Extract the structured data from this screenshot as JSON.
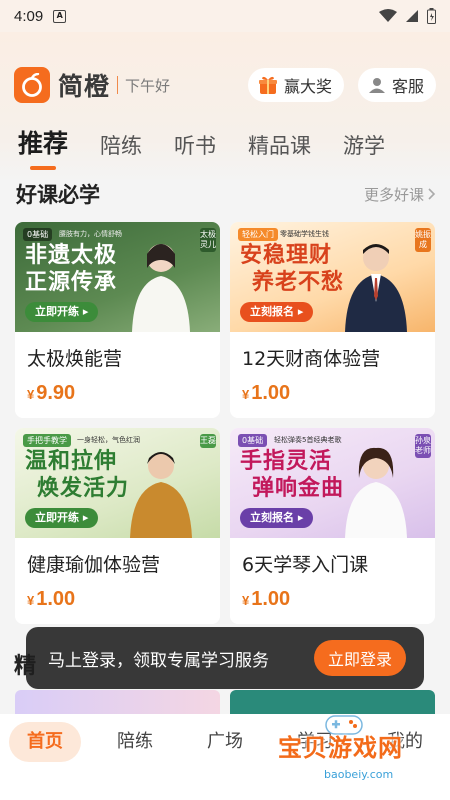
{
  "status_bar": {
    "time": "4:09",
    "sim_glyph": "A"
  },
  "app": {
    "name": "简橙",
    "greeting": "下午好"
  },
  "header": {
    "prize_label": "赢大奖",
    "service_label": "客服"
  },
  "tabs": [
    {
      "label": "推荐",
      "active": true
    },
    {
      "label": "陪练",
      "active": false
    },
    {
      "label": "听书",
      "active": false
    },
    {
      "label": "精品课",
      "active": false
    },
    {
      "label": "游学",
      "active": false
    }
  ],
  "section": {
    "title": "好课必学",
    "more_label": "更多好课"
  },
  "courses": [
    {
      "tag": "0基础",
      "tag_sub": "腰肢有力，心情舒畅",
      "banner_lines": [
        "非遗太极",
        "正源传承"
      ],
      "cta": "立即开练",
      "teacher": "太极灵儿",
      "title": "太极焕能营",
      "currency": "¥",
      "price": "9.90"
    },
    {
      "tag": "轻松入门",
      "tag_sub": "零基础学钱生钱",
      "banner_lines": [
        "安稳理财",
        "养老不愁"
      ],
      "cta": "立刻报名",
      "teacher": "姚振成",
      "title": "12天财商体验营",
      "currency": "¥",
      "price": "1.00"
    },
    {
      "tag": "手把手教学",
      "tag_sub": "一身轻松，气色红润",
      "banner_lines": [
        "温和拉伸",
        "焕发活力"
      ],
      "cta": "立即开练",
      "teacher": "王磊",
      "title": "健康瑜伽体验营",
      "currency": "¥",
      "price": "1.00"
    },
    {
      "tag": "0基础",
      "tag_sub": "轻松弹奏5首经典老歌",
      "banner_lines": [
        "手指灵活",
        "弹响金曲"
      ],
      "cta": "立刻报名",
      "teacher": "孙泉老师",
      "title": "6天学琴入门课",
      "currency": "¥",
      "price": "1.00"
    }
  ],
  "login_toast": {
    "text": "马上登录，领取专属学习服务",
    "button": "立即登录"
  },
  "next_section_peek": "精",
  "bottom_nav": [
    {
      "label": "首页",
      "active": true
    },
    {
      "label": "陪练",
      "active": false
    },
    {
      "label": "广场",
      "active": false
    },
    {
      "label": "学习",
      "active": false
    },
    {
      "label": "我的",
      "active": false
    }
  ],
  "watermark": {
    "text": "宝贝游戏网",
    "url": "baobeiy.com"
  },
  "colors": {
    "accent": "#f56c1e",
    "price": "#e8741a"
  }
}
